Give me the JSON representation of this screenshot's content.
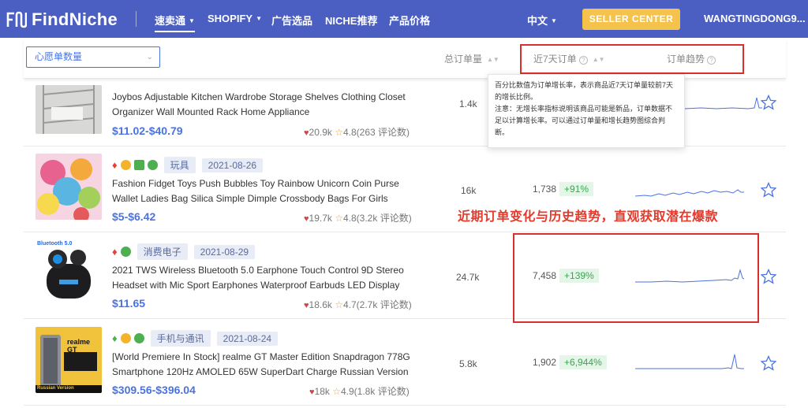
{
  "header": {
    "logo_text": "FindNiche",
    "nav": [
      {
        "label": "速卖通",
        "has_caret": true
      },
      {
        "label": "SHOPIFY",
        "has_caret": true
      },
      {
        "label": "广告选品"
      },
      {
        "label": "NICHE推荐"
      },
      {
        "label": "产品价格"
      }
    ],
    "language": "中文",
    "seller_center": "SELLER CENTER",
    "username": "WANGTINGDONG9...",
    "colors": {
      "bar": "#4a5fc1",
      "seller_btn": "#f5c24b"
    }
  },
  "filter": {
    "select_value": "心愿单数量",
    "columns": {
      "total_orders": "总订单量",
      "orders_7d": "近7天订单",
      "trend": "订单趋势"
    }
  },
  "tooltip": {
    "line1": "百分比数值为订单增长率，表示商品近7天订单量较前7天的增长比例。",
    "line2": "注意：无增长率指标说明该商品可能是新品，订单数据不足以计算增长率。可以通过订单量和增长趋势图综合判断。"
  },
  "annotation": "近期订单变化与历史趋势，直观获取潜在爆款",
  "products": [
    {
      "title1": "Joybos Adjustable Kitchen Wardrobe Storage Shelves Clothing Closet",
      "title2": "Organizer Wall Mounted Rack Home Appliance",
      "price": "$11.02-$40.79",
      "wishlist": "20.9k",
      "rating": "4.8(263 评论数)",
      "total_orders": "1.4k",
      "thumb": "shelves-image"
    },
    {
      "category": "玩具",
      "date": "2021-08-26",
      "title1": "Fashion Fidget Toys Push Bubbles Toy Rainbow Unicorn Coin Purse",
      "title2": "Wallet Ladies Bag Silica Simple Dimple Crossbody Bags For Girls",
      "price": "$5-$6.42",
      "wishlist": "19.7k",
      "rating": "4.8(3.2k 评论数)",
      "total_orders": "16k",
      "orders_7d": "1,738",
      "growth": "+91%",
      "thumb": "fidget-toys-image"
    },
    {
      "category": "消费电子",
      "date": "2021-08-29",
      "title1": "2021 TWS Wireless Bluetooth 5.0 Earphone Touch Control 9D Stereo",
      "title2": "Headset with Mic Sport Earphones Waterproof Earbuds LED Display",
      "price": "$11.65",
      "wishlist": "18.6k",
      "rating": "4.7(2.7k 评论数)",
      "total_orders": "24.7k",
      "orders_7d": "7,458",
      "growth": "+139%",
      "thumb_label": "Bluetooth 5.0",
      "thumb": "earbuds-image"
    },
    {
      "category": "手机与通讯",
      "date": "2021-08-24",
      "title1": "[World Premiere In Stock] realme GT Master Edition Snapdragon 778G",
      "title2": "Smartphone 120Hz AMOLED 65W SuperDart Charge Russian Version",
      "price": "$309.56-$396.04",
      "wishlist": "18k",
      "rating": "4.9(1.8k 评论数)",
      "total_orders": "5.8k",
      "orders_7d": "1,902",
      "growth": "+6,944%",
      "thumb_label": "realme GT",
      "thumb_sub": "Russian Version",
      "thumb": "phone-image"
    }
  ]
}
